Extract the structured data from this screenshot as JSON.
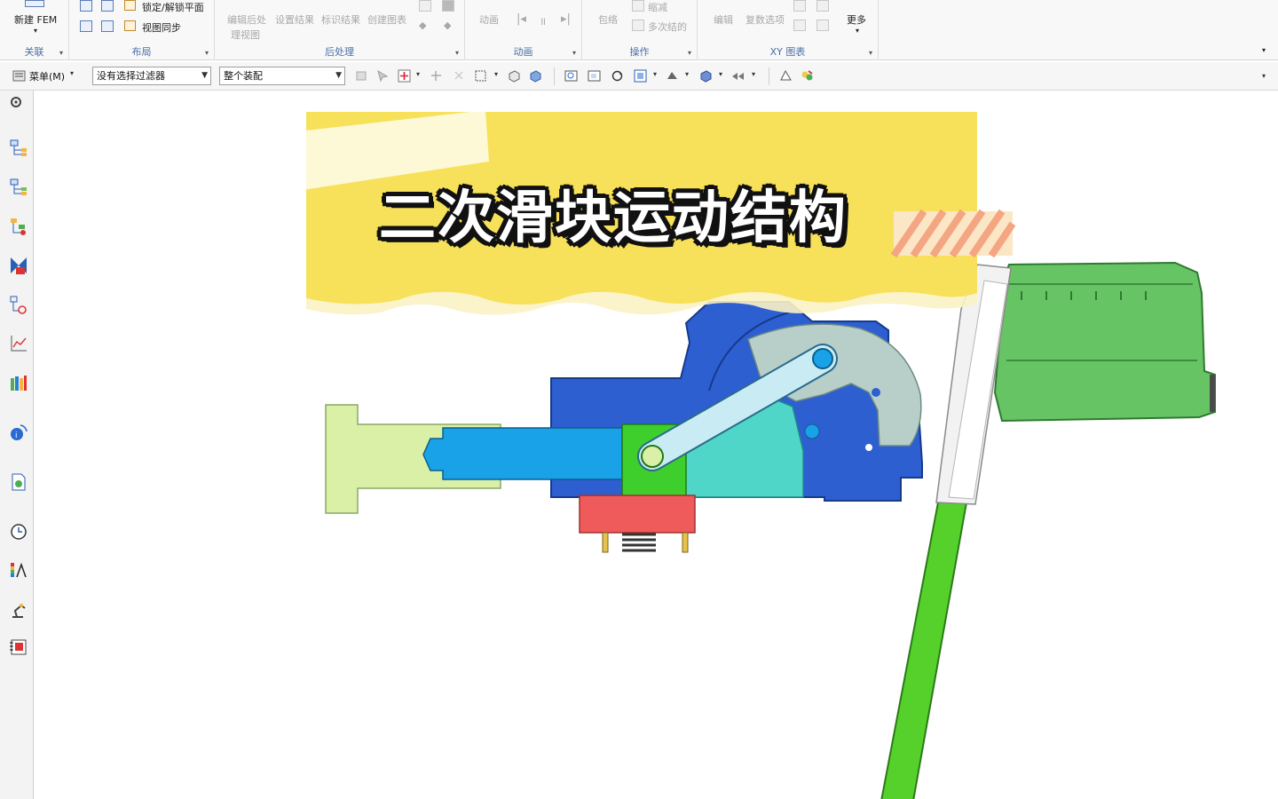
{
  "ribbon": {
    "groups": [
      {
        "label": "关联"
      },
      {
        "label": "布局"
      },
      {
        "label": "后处理"
      },
      {
        "label": "动画"
      },
      {
        "label": "操作"
      },
      {
        "label": "XY 图表"
      }
    ],
    "new_fem": "新建 FEM",
    "lock_plane": "锁定/解锁平面",
    "view_sync": "视图同步",
    "edit_post_line1": "编辑后处",
    "edit_post_line2": "理视图",
    "set_result": "设置结果",
    "mark_result": "标识结果",
    "create_chart": "创建图表",
    "animation": "动画",
    "envelope": "包络",
    "shrink": "缩减",
    "multi_result": "多次结的",
    "edit": "编辑",
    "complex_options": "复数选项",
    "more": "更多"
  },
  "toolbar": {
    "menu_label": "菜单(M)",
    "filter_value": "没有选择过滤器",
    "assembly_value": "整个装配"
  },
  "viewport": {
    "title": "二次滑块运动结构"
  },
  "colors": {
    "blue_part": "#2d5fd1",
    "cyan_rod": "#19a2e8",
    "light_green": "#d9f0a6",
    "green_part": "#66c464",
    "bright_green": "#56d12c",
    "gray_disc": "#b8cfc9",
    "red_block": "#ef5a5a",
    "yellow_banner": "#f7e15a"
  }
}
